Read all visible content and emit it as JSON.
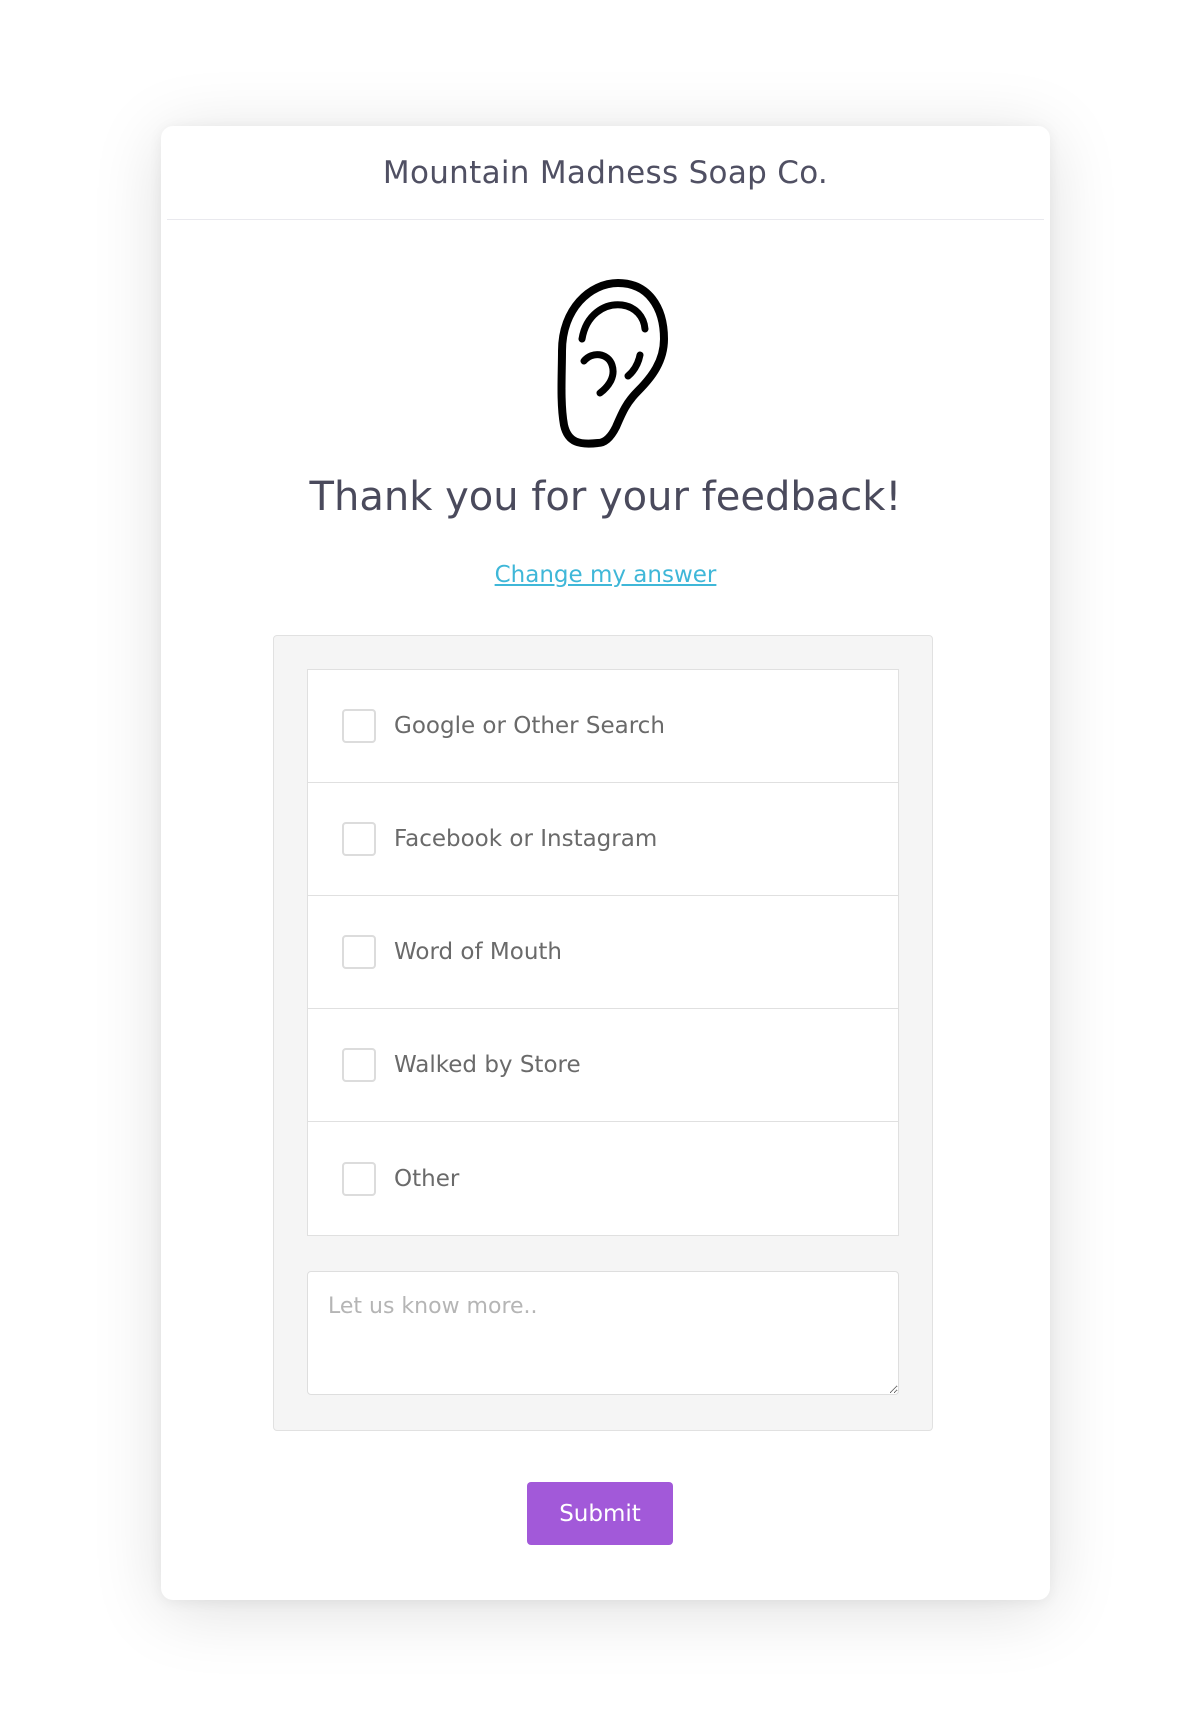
{
  "header": {
    "brand": "Mountain Madness Soap Co."
  },
  "hero": {
    "icon": "ear-icon",
    "title": "Thank you for your feedback!",
    "change_link": "Change my answer"
  },
  "options": [
    {
      "label": "Google or Other Search",
      "checked": false
    },
    {
      "label": "Facebook or Instagram",
      "checked": false
    },
    {
      "label": "Word of Mouth",
      "checked": false
    },
    {
      "label": "Walked by Store",
      "checked": false
    },
    {
      "label": "Other",
      "checked": false
    }
  ],
  "comment": {
    "value": "",
    "placeholder": "Let us know more.."
  },
  "submit": {
    "label": "Submit"
  },
  "colors": {
    "accent": "#a259d9",
    "link": "#3fb7d8",
    "text": "#4a4a5c",
    "panel": "#f5f5f5"
  }
}
